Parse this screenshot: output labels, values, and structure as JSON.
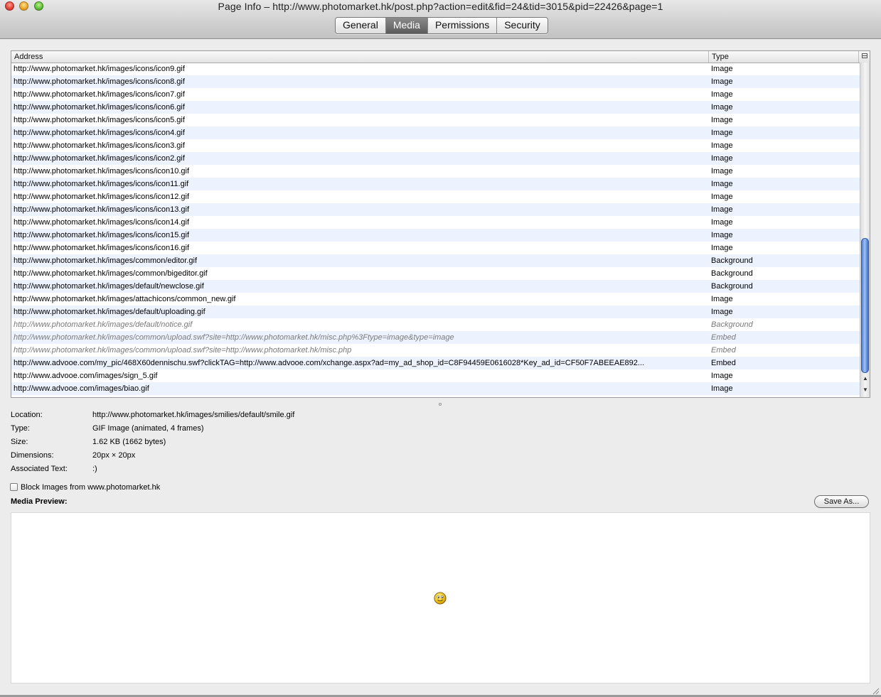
{
  "window": {
    "title": "Page Info – http://www.photomarket.hk/post.php?action=edit&fid=24&tid=3015&pid=22426&page=1"
  },
  "tabs": [
    {
      "label": "General",
      "active": false
    },
    {
      "label": "Media",
      "active": true
    },
    {
      "label": "Permissions",
      "active": false
    },
    {
      "label": "Security",
      "active": false
    }
  ],
  "table": {
    "columns": {
      "address": "Address",
      "type": "Type"
    },
    "rows": [
      {
        "address": "http://www.photomarket.hk/images/icons/icon9.gif",
        "type": "Image"
      },
      {
        "address": "http://www.photomarket.hk/images/icons/icon8.gif",
        "type": "Image"
      },
      {
        "address": "http://www.photomarket.hk/images/icons/icon7.gif",
        "type": "Image"
      },
      {
        "address": "http://www.photomarket.hk/images/icons/icon6.gif",
        "type": "Image"
      },
      {
        "address": "http://www.photomarket.hk/images/icons/icon5.gif",
        "type": "Image"
      },
      {
        "address": "http://www.photomarket.hk/images/icons/icon4.gif",
        "type": "Image"
      },
      {
        "address": "http://www.photomarket.hk/images/icons/icon3.gif",
        "type": "Image"
      },
      {
        "address": "http://www.photomarket.hk/images/icons/icon2.gif",
        "type": "Image"
      },
      {
        "address": "http://www.photomarket.hk/images/icons/icon10.gif",
        "type": "Image"
      },
      {
        "address": "http://www.photomarket.hk/images/icons/icon11.gif",
        "type": "Image"
      },
      {
        "address": "http://www.photomarket.hk/images/icons/icon12.gif",
        "type": "Image"
      },
      {
        "address": "http://www.photomarket.hk/images/icons/icon13.gif",
        "type": "Image"
      },
      {
        "address": "http://www.photomarket.hk/images/icons/icon14.gif",
        "type": "Image"
      },
      {
        "address": "http://www.photomarket.hk/images/icons/icon15.gif",
        "type": "Image"
      },
      {
        "address": "http://www.photomarket.hk/images/icons/icon16.gif",
        "type": "Image"
      },
      {
        "address": "http://www.photomarket.hk/images/common/editor.gif",
        "type": "Background"
      },
      {
        "address": "http://www.photomarket.hk/images/common/bigeditor.gif",
        "type": "Background"
      },
      {
        "address": "http://www.photomarket.hk/images/default/newclose.gif",
        "type": "Background"
      },
      {
        "address": "http://www.photomarket.hk/images/attachicons/common_new.gif",
        "type": "Image"
      },
      {
        "address": "http://www.photomarket.hk/images/default/uploading.gif",
        "type": "Image"
      },
      {
        "address": "http://www.photomarket.hk/images/default/notice.gif",
        "type": "Background",
        "dim": true
      },
      {
        "address": "http://www.photomarket.hk/images/common/upload.swf?site=http://www.photomarket.hk/misc.php%3Ftype=image&type=image",
        "type": "Embed",
        "dim": true
      },
      {
        "address": "http://www.photomarket.hk/images/common/upload.swf?site=http://www.photomarket.hk/misc.php",
        "type": "Embed",
        "dim": true
      },
      {
        "address": "http://www.advooe.com/my_pic/468X60dennischu.swf?clickTAG=http://www.advooe.com/xchange.aspx?ad=my_ad_shop_id=C8F94459E0616028*Key_ad_id=CF50F7ABEEAE892...",
        "type": "Embed"
      },
      {
        "address": "http://www.advooe.com/images/sign_5.gif",
        "type": "Image"
      },
      {
        "address": "http://www.advooe.com/images/biao.gif",
        "type": "Image"
      }
    ]
  },
  "details": {
    "location_label": "Location:",
    "location": "http://www.photomarket.hk/images/smilies/default/smile.gif",
    "type_label": "Type:",
    "type": "GIF Image (animated, 4 frames)",
    "size_label": "Size:",
    "size": "1.62 KB (1662 bytes)",
    "dimensions_label": "Dimensions:",
    "dimensions": "20px × 20px",
    "assoc_label": "Associated Text:",
    "assoc": ":)"
  },
  "block_images_label": "Block Images from www.photomarket.hk",
  "preview_label": "Media Preview:",
  "save_as_label": "Save As...",
  "colors": {
    "row_alt": "#edf3fe",
    "scroll_thumb": "#5a8ae0",
    "active_tab": "#6a6a6a"
  }
}
